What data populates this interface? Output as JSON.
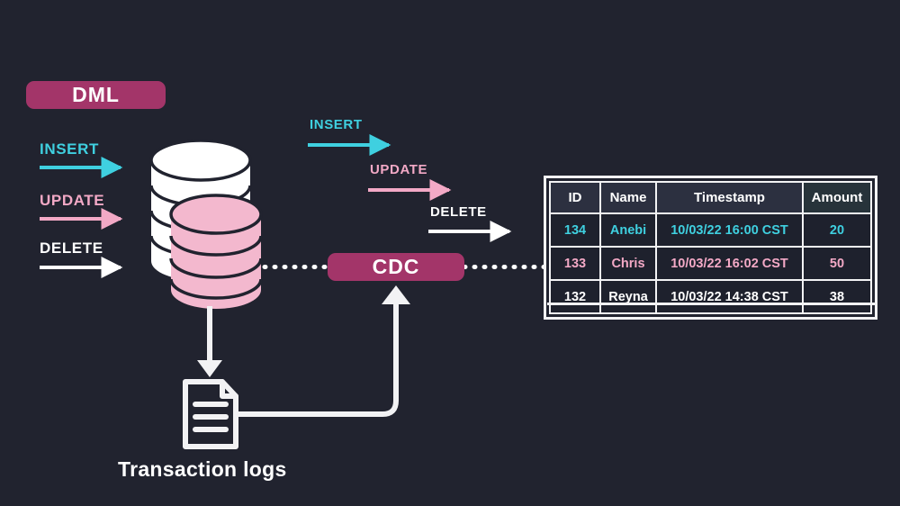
{
  "theme": {
    "background": "#21232f",
    "accent_magenta": "#a33569",
    "insert_cyan": "#3fd0e0",
    "update_pink": "#f3a9c6",
    "delete_white": "#ffffff",
    "table_border": "#f2f2f4"
  },
  "badges": {
    "dml": "DML",
    "cdc": "CDC"
  },
  "left_operations": [
    {
      "label": "INSERT",
      "color": "#3fd0e0"
    },
    {
      "label": "UPDATE",
      "color": "#f3a9c6"
    },
    {
      "label": "DELETE",
      "color": "#ffffff"
    }
  ],
  "middle_operations": [
    {
      "label": "INSERT",
      "color": "#3fd0e0"
    },
    {
      "label": "UPDATE",
      "color": "#f3a9c6"
    },
    {
      "label": "DELETE",
      "color": "#ffffff"
    }
  ],
  "nodes": {
    "database_label": "database-cylinders",
    "transaction_logs": "Transaction logs"
  },
  "table": {
    "columns": [
      "ID",
      "Name",
      "Timestamp",
      "Amount"
    ],
    "rows": [
      {
        "id": "134",
        "name": "Anebi",
        "timestamp": "10/03/22 16:00 CST",
        "amount": "20",
        "state": "inserted"
      },
      {
        "id": "133",
        "name": "Chris",
        "timestamp": "10/03/22 16:02 CST",
        "amount": "50",
        "state": "updated"
      },
      {
        "id": "132",
        "name": "Reyna",
        "timestamp": "10/03/22 14:38 CST",
        "amount": "38",
        "state": "deleted"
      }
    ]
  }
}
